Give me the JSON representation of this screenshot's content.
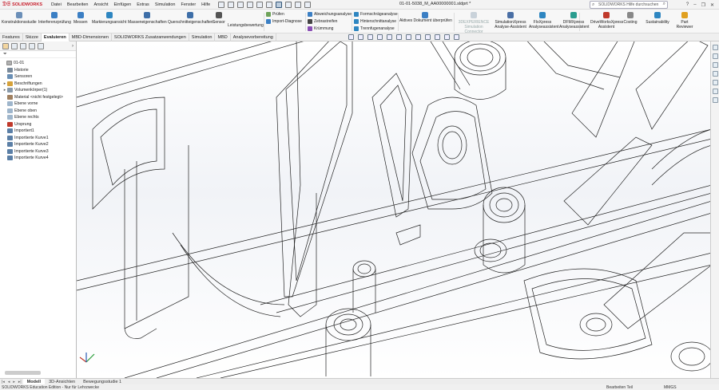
{
  "app": {
    "brand": "SOLIDWORKS",
    "doc_title": "01-01-5038_M_AA00000001.sldprt *",
    "help_search_placeholder": "SOLIDWORKS Hilfe durchsuchen"
  },
  "menus": [
    "Datei",
    "Bearbeiten",
    "Ansicht",
    "Einfügen",
    "Extras",
    "Simulation",
    "Fenster",
    "Hilfe"
  ],
  "ribbon": {
    "big_buttons": [
      {
        "label": "Konstruktionsstudie",
        "icon": "design-study-icon"
      },
      {
        "label": "Interferenzprüfung",
        "icon": "interference-icon"
      },
      {
        "label": "Messen",
        "icon": "measure-icon"
      },
      {
        "label": "Markierungsansicht",
        "icon": "markup-icon"
      },
      {
        "label": "Masseneigenschaften",
        "icon": "mass-props-icon"
      },
      {
        "label": "Querschnitteigenschaften",
        "icon": "section-props-icon"
      },
      {
        "label": "Sensor",
        "icon": "sensor-icon"
      },
      {
        "label": "Leistungsbewertung",
        "icon": "performance-icon"
      }
    ],
    "small_group1": [
      {
        "label": "Prüfen",
        "icon": "check-icon"
      },
      {
        "label": "Import-Diagnose",
        "icon": "import-diagnostics-icon"
      }
    ],
    "small_group2": [
      {
        "label": "Abweichungsanalyse",
        "icon": "deviation-icon"
      },
      {
        "label": "Zebrastreifen",
        "icon": "zebra-icon"
      },
      {
        "label": "Krümmung",
        "icon": "curvature-icon"
      }
    ],
    "small_group3": [
      {
        "label": "Formschrägeanalyse",
        "icon": "draft-analysis-icon"
      },
      {
        "label": "Hinterschnittanalyse",
        "icon": "undercut-icon"
      },
      {
        "label": "Trennfugenanalyse",
        "icon": "parting-line-icon"
      }
    ],
    "compare_button": {
      "label": "Aktives Dokument überprüfen",
      "icon": "compare-icon"
    },
    "right_buttons": [
      {
        "label": "3DEXPERIENCE Simulation Connector",
        "icon": "3dx-icon",
        "dim": true
      },
      {
        "label": "SimulationXpress Analyse-Assistent",
        "icon": "simxpress-icon",
        "dim": false
      },
      {
        "label": "FloXpress Analyseassistent",
        "icon": "floxpress-icon",
        "dim": false
      },
      {
        "label": "DFMXpress Analyseassistent",
        "icon": "dfmxpress-icon",
        "dim": false
      },
      {
        "label": "DriveWorksXpress Assistent",
        "icon": "driveworks-icon",
        "dim": false
      },
      {
        "label": "Costing",
        "icon": "costing-icon",
        "dim": false
      },
      {
        "label": "Sustainability",
        "icon": "sustainability-icon",
        "dim": false
      },
      {
        "label": "Part Reviewer",
        "icon": "part-reviewer-icon",
        "dim": false
      }
    ]
  },
  "tabs": [
    {
      "label": "Features",
      "active": false
    },
    {
      "label": "Skizze",
      "active": false
    },
    {
      "label": "Evaluieren",
      "active": true
    },
    {
      "label": "MBD-Dimensionen",
      "active": false
    },
    {
      "label": "SOLIDWORKS Zusatzanwendungen",
      "active": false
    },
    {
      "label": "Simulation",
      "active": false
    },
    {
      "label": "MBD",
      "active": false
    },
    {
      "label": "Analysevorbereitung",
      "active": false
    }
  ],
  "feature_tree": [
    {
      "label": "01-01",
      "toggle": "",
      "icon": "part-icon",
      "color": "#b0b0b0",
      "indent": 0
    },
    {
      "label": "Historie",
      "toggle": "",
      "icon": "history-icon",
      "color": "#7a8a9a",
      "indent": 1
    },
    {
      "label": "Sensoren",
      "toggle": "",
      "icon": "sensor-icon",
      "color": "#6a8fb5",
      "indent": 1
    },
    {
      "label": "Beschriftungen",
      "toggle": "▸",
      "icon": "annotation-icon",
      "color": "#d6a23a",
      "indent": 1
    },
    {
      "label": "Volumenkörper(1)",
      "toggle": "▸",
      "icon": "solid-bodies-icon",
      "color": "#8899aa",
      "indent": 1
    },
    {
      "label": "Material <nicht festgelegt>",
      "toggle": "",
      "icon": "material-icon",
      "color": "#a08060",
      "indent": 1
    },
    {
      "label": "Ebene vorne",
      "toggle": "",
      "icon": "plane-icon",
      "color": "#9fb6cc",
      "indent": 1
    },
    {
      "label": "Ebene oben",
      "toggle": "",
      "icon": "plane-icon",
      "color": "#9fb6cc",
      "indent": 1
    },
    {
      "label": "Ebene rechts",
      "toggle": "",
      "icon": "plane-icon",
      "color": "#9fb6cc",
      "indent": 1
    },
    {
      "label": "Ursprung",
      "toggle": "",
      "icon": "origin-icon",
      "color": "#c0392b",
      "indent": 1
    },
    {
      "label": "Importiert1",
      "toggle": "",
      "icon": "imported-icon",
      "color": "#5b7fa6",
      "indent": 1
    },
    {
      "label": "Importierte Kurve1",
      "toggle": "",
      "icon": "curve-icon",
      "color": "#5b7fa6",
      "indent": 1
    },
    {
      "label": "Importierte Kurve2",
      "toggle": "",
      "icon": "curve-icon",
      "color": "#5b7fa6",
      "indent": 1
    },
    {
      "label": "Importierte Kurve3",
      "toggle": "",
      "icon": "curve-icon",
      "color": "#5b7fa6",
      "indent": 1
    },
    {
      "label": "Importierte Kurve4",
      "toggle": "",
      "icon": "curve-icon",
      "color": "#5b7fa6",
      "indent": 1
    }
  ],
  "bottom_tabs": [
    {
      "label": "Modell",
      "active": true
    },
    {
      "label": "3D-Ansichten",
      "active": false
    },
    {
      "label": "Bewegungsstudie 1",
      "active": false
    }
  ],
  "status": {
    "edition": "SOLIDWORKS Education Edition - Nur für Lehrzwecke",
    "mode": "Bearbeiten Teil",
    "units": "MMGS"
  },
  "colors": {
    "brand_red": "#c8202e",
    "viewport_bg": "#fdfdfd"
  }
}
